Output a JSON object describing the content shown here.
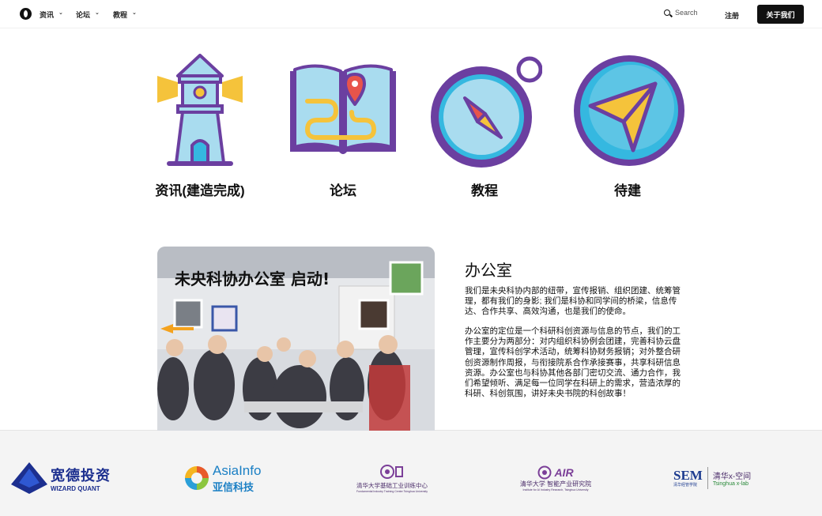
{
  "nav": {
    "items": [
      {
        "label": "资讯"
      },
      {
        "label": "论坛"
      },
      {
        "label": "教程"
      }
    ],
    "search_placeholder": "Search",
    "register_label": "注册",
    "about_label": "关于我们"
  },
  "features": [
    {
      "label": "资讯(建造完成)",
      "icon": "lighthouse-icon"
    },
    {
      "label": "论坛",
      "icon": "map-book-icon"
    },
    {
      "label": "教程",
      "icon": "compass-icon"
    },
    {
      "label": "待建",
      "icon": "paper-plane-icon"
    }
  ],
  "office": {
    "title": "办公室",
    "paragraph1": "我们是未央科协内部的纽带，宣传报销、组织团建、统筹管理，都有我们的身影; 我们是科协和同学间的桥梁，信息传达、合作共享、高效沟通，也是我们的使命。",
    "paragraph2": "办公室的定位是一个科研科创资源与信息的节点，我们的工作主要分为两部分：对内组织科协例会团建，完善科协云盘管理，宣传科创学术活动，统筹科协财务报销；对外整合研创资源制作周报，与衔接院系合作承接赛事，共享科研信息资源。办公室也与科协其他各部门密切交流、通力合作，我们希望倾听、满足每一位同学在科研上的需求，营造浓厚的科研、科创氛围，讲好未央书院的科创故事！",
    "photo_banner": "未央科协办公室 启动!"
  },
  "partners": [
    {
      "name": "宽德投资",
      "sub": "WIZARD QUANT"
    },
    {
      "name": "AsiaInfo",
      "sub": "亚信科技"
    },
    {
      "name": "清华大学基础工业训练中心",
      "sub": "Fundamental Industry Training Center  Tsinghua University"
    },
    {
      "name": "清华大学 智能产业研究院",
      "badge": "AIR",
      "sub": "Institute for AI Industry Research, Tsinghua University"
    },
    {
      "name": "SEM",
      "cn": "清华经管学院",
      "name2": "清华x-空间",
      "sub2": "Tsinghua x-lab"
    }
  ],
  "colors": {
    "purple": "#6b3fa0",
    "light_blue": "#a9dcef",
    "yellow": "#f5c33b",
    "red": "#e8544b",
    "cyan": "#35b8e0",
    "nav_button": "#111111"
  }
}
